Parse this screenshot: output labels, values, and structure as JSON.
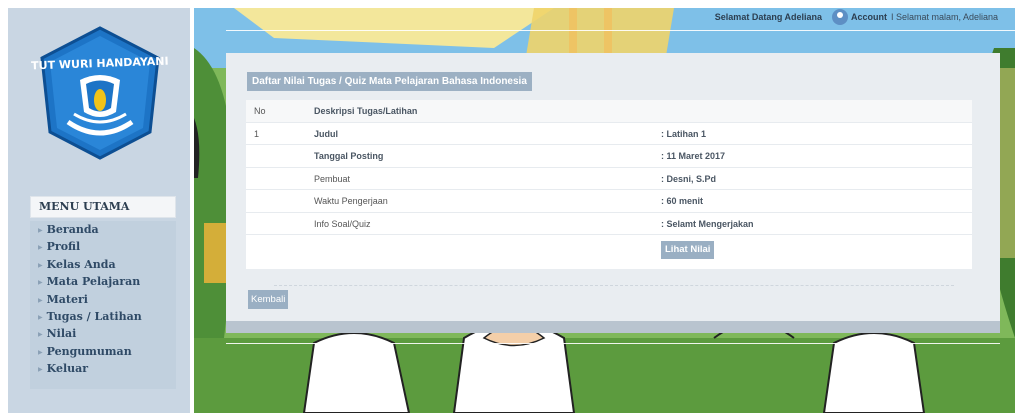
{
  "sidebar": {
    "logo_text": "TUT WURI HANDAYANI",
    "menu_header": "MENU UTAMA",
    "items": [
      {
        "label": "Beranda"
      },
      {
        "label": "Profil"
      },
      {
        "label": "Kelas Anda"
      },
      {
        "label": "Mata Pelajaran"
      },
      {
        "label": "Materi"
      },
      {
        "label": "Tugas / Latihan"
      },
      {
        "label": "Nilai"
      },
      {
        "label": "Pengumuman"
      },
      {
        "label": "Keluar"
      }
    ]
  },
  "topbar": {
    "welcome": "Selamat Datang Adeliana",
    "account": "Account",
    "greeting": "I Selamat malam, Adeliana"
  },
  "panel": {
    "title": "Daftar Nilai Tugas / Quiz Mata Pelajaran Bahasa Indonesia",
    "header": {
      "no": "No",
      "desc": "Deskripsi Tugas/Latihan"
    },
    "number": "1",
    "rows": [
      {
        "label": "Judul",
        "value": ": Latihan 1"
      },
      {
        "label": "Tanggal Posting",
        "value": ": 11 Maret 2017"
      },
      {
        "label": "Pembuat",
        "value": ": Desni, S.Pd"
      },
      {
        "label": "Waktu Pengerjaan",
        "value": ": 60 menit"
      },
      {
        "label": "Info Soal/Quiz",
        "value": ": Selamt Mengerjakan"
      }
    ],
    "lihat_nilai": "Lihat Nilai",
    "kembali": "Kembali"
  },
  "colors": {
    "sidebar_bg": "#c9d6e3",
    "button_bg": "#9aafc3",
    "panel_bg": "#e9edf1"
  }
}
